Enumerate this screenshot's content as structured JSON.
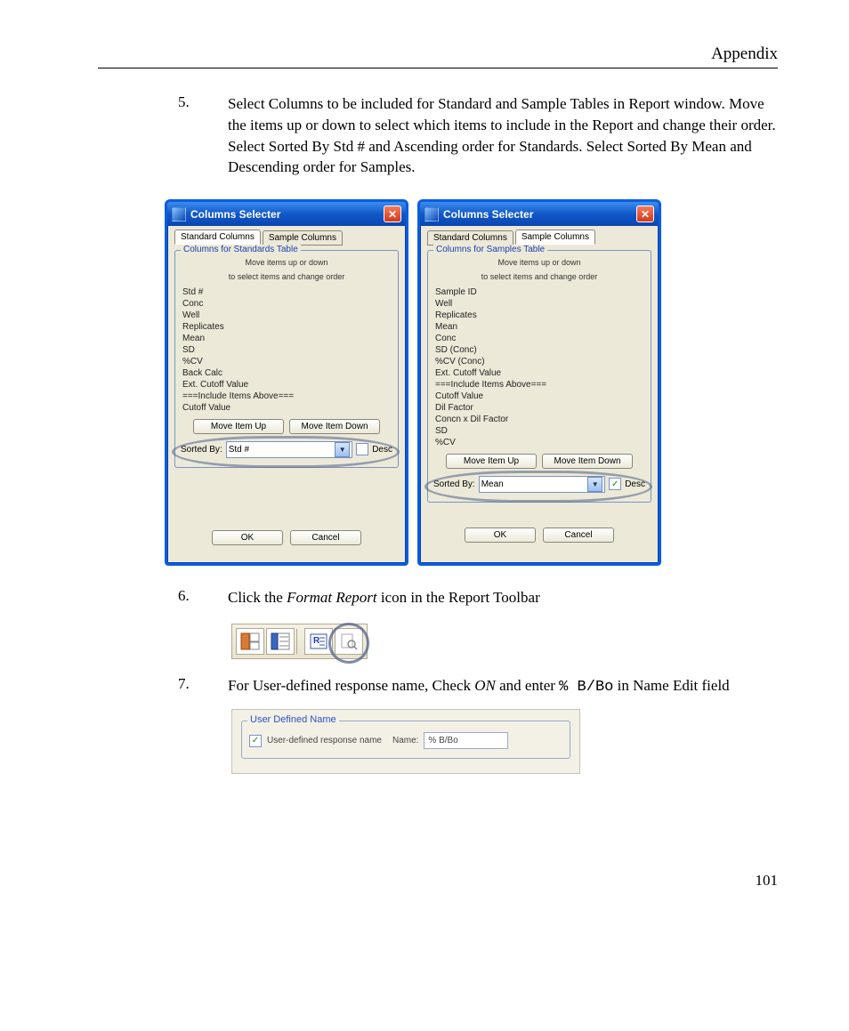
{
  "header": {
    "title": "Appendix"
  },
  "steps": {
    "s5": {
      "num": "5.",
      "text": "Select Columns to be included for Standard and Sample Tables in Report window. Move the items up or down to select which items to include in the Report and change their order. Select Sorted By Std # and Ascending order for Standards. Select Sorted By Mean and Descending order for Samples."
    },
    "s6": {
      "num": "6.",
      "prefix": "Click the ",
      "italic": "Format Report",
      "suffix": " icon in the Report Toolbar"
    },
    "s7": {
      "num": "7.",
      "prefix": "For User-defined response name, Check ",
      "italic": "ON",
      "mid": " and enter ",
      "mono": "% B/Bo",
      "suffix": " in Name Edit field"
    }
  },
  "dialogA": {
    "title": "Columns Selecter",
    "close": "✕",
    "tabs": {
      "active": "Standard Columns",
      "inactive": "Sample Columns"
    },
    "groupTitle": "Columns for Standards Table",
    "hint1": "Move items up or down",
    "hint2": "to select items and change order",
    "items": [
      "Std #",
      "Conc",
      "Well",
      "Replicates",
      "Mean",
      "SD",
      "%CV",
      "Back Calc",
      "Ext. Cutoff Value",
      "===Include Items Above===",
      "Cutoff Value"
    ],
    "moveUp": "Move Item Up",
    "moveDown": "Move Item Down",
    "sortedByLabel": "Sorted By:",
    "sortedByValue": "Std #",
    "descLabel": "Desc",
    "descChecked": "",
    "ok": "OK",
    "cancel": "Cancel"
  },
  "dialogB": {
    "title": "Columns Selecter",
    "close": "✕",
    "tabs": {
      "inactive": "Standard Columns",
      "active": "Sample Columns"
    },
    "groupTitle": "Columns for Samples Table",
    "hint1": "Move items up or down",
    "hint2": "to select items and change order",
    "items": [
      "Sample ID",
      "Well",
      "Replicates",
      "Mean",
      "Conc",
      "SD (Conc)",
      "%CV (Conc)",
      "Ext. Cutoff Value",
      "===Include Items Above===",
      "Cutoff Value",
      "Dil Factor",
      "Concn x Dil Factor",
      "SD",
      "%CV"
    ],
    "moveUp": "Move Item Up",
    "moveDown": "Move Item Down",
    "sortedByLabel": "Sorted By:",
    "sortedByValue": "Mean",
    "descLabel": "Desc",
    "descChecked": "✓",
    "ok": "OK",
    "cancel": "Cancel"
  },
  "toolbar": {
    "icons": [
      "toolbar-icon-1",
      "toolbar-icon-2",
      "toolbar-icon-3",
      "format-report-icon",
      "magnify-icon"
    ]
  },
  "udn": {
    "groupTitle": "User Defined Name",
    "chk": "✓",
    "chkLabel": "User-defined response name",
    "nameLabel": "Name:",
    "value": "% B/Bo"
  },
  "pageNumber": "101"
}
